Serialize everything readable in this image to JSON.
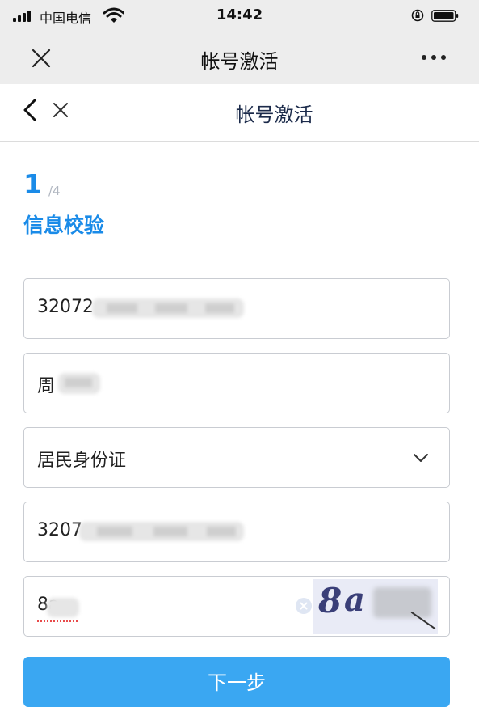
{
  "status_bar": {
    "carrier": "中国电信",
    "time": "14:42"
  },
  "wechat_header": {
    "title": "帐号激活"
  },
  "page_nav": {
    "title": "帐号激活"
  },
  "step": {
    "current": "1",
    "total": "/4",
    "title": "信息校验"
  },
  "form": {
    "account_value": "32072",
    "name_value": "周",
    "id_type_value": "居民身份证",
    "id_number_value": "3207",
    "captcha_value": "8a",
    "captcha_image_chars": [
      "8",
      "a"
    ]
  },
  "buttons": {
    "next_label": "下一步"
  },
  "colors": {
    "accent": "#1a8be8",
    "button": "#3aa7f2"
  },
  "icons": [
    "signal-icon",
    "wifi-icon",
    "orientation-lock-icon",
    "battery-icon",
    "close-icon",
    "more-icon",
    "back-icon",
    "chevron-down-icon",
    "clear-icon"
  ]
}
